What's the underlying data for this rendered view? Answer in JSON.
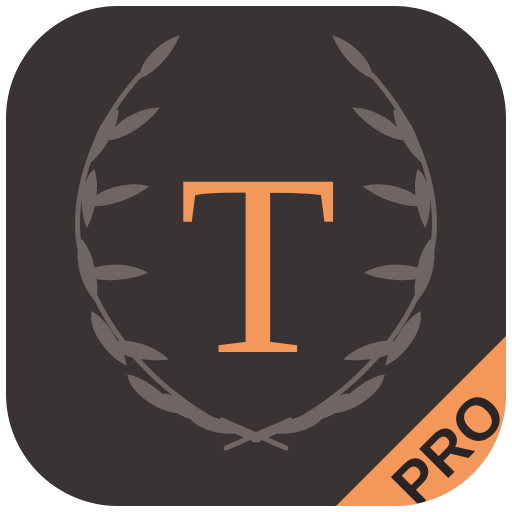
{
  "app_icon": {
    "monogram": "T",
    "badge_label": "PRO",
    "colors": {
      "background": "#3a3333",
      "laurel": "#6e6663",
      "monogram": "#f4975a",
      "badge": "#f4975a",
      "badge_text": "#2a2424"
    },
    "decoration": "laurel-wreath-icon"
  }
}
